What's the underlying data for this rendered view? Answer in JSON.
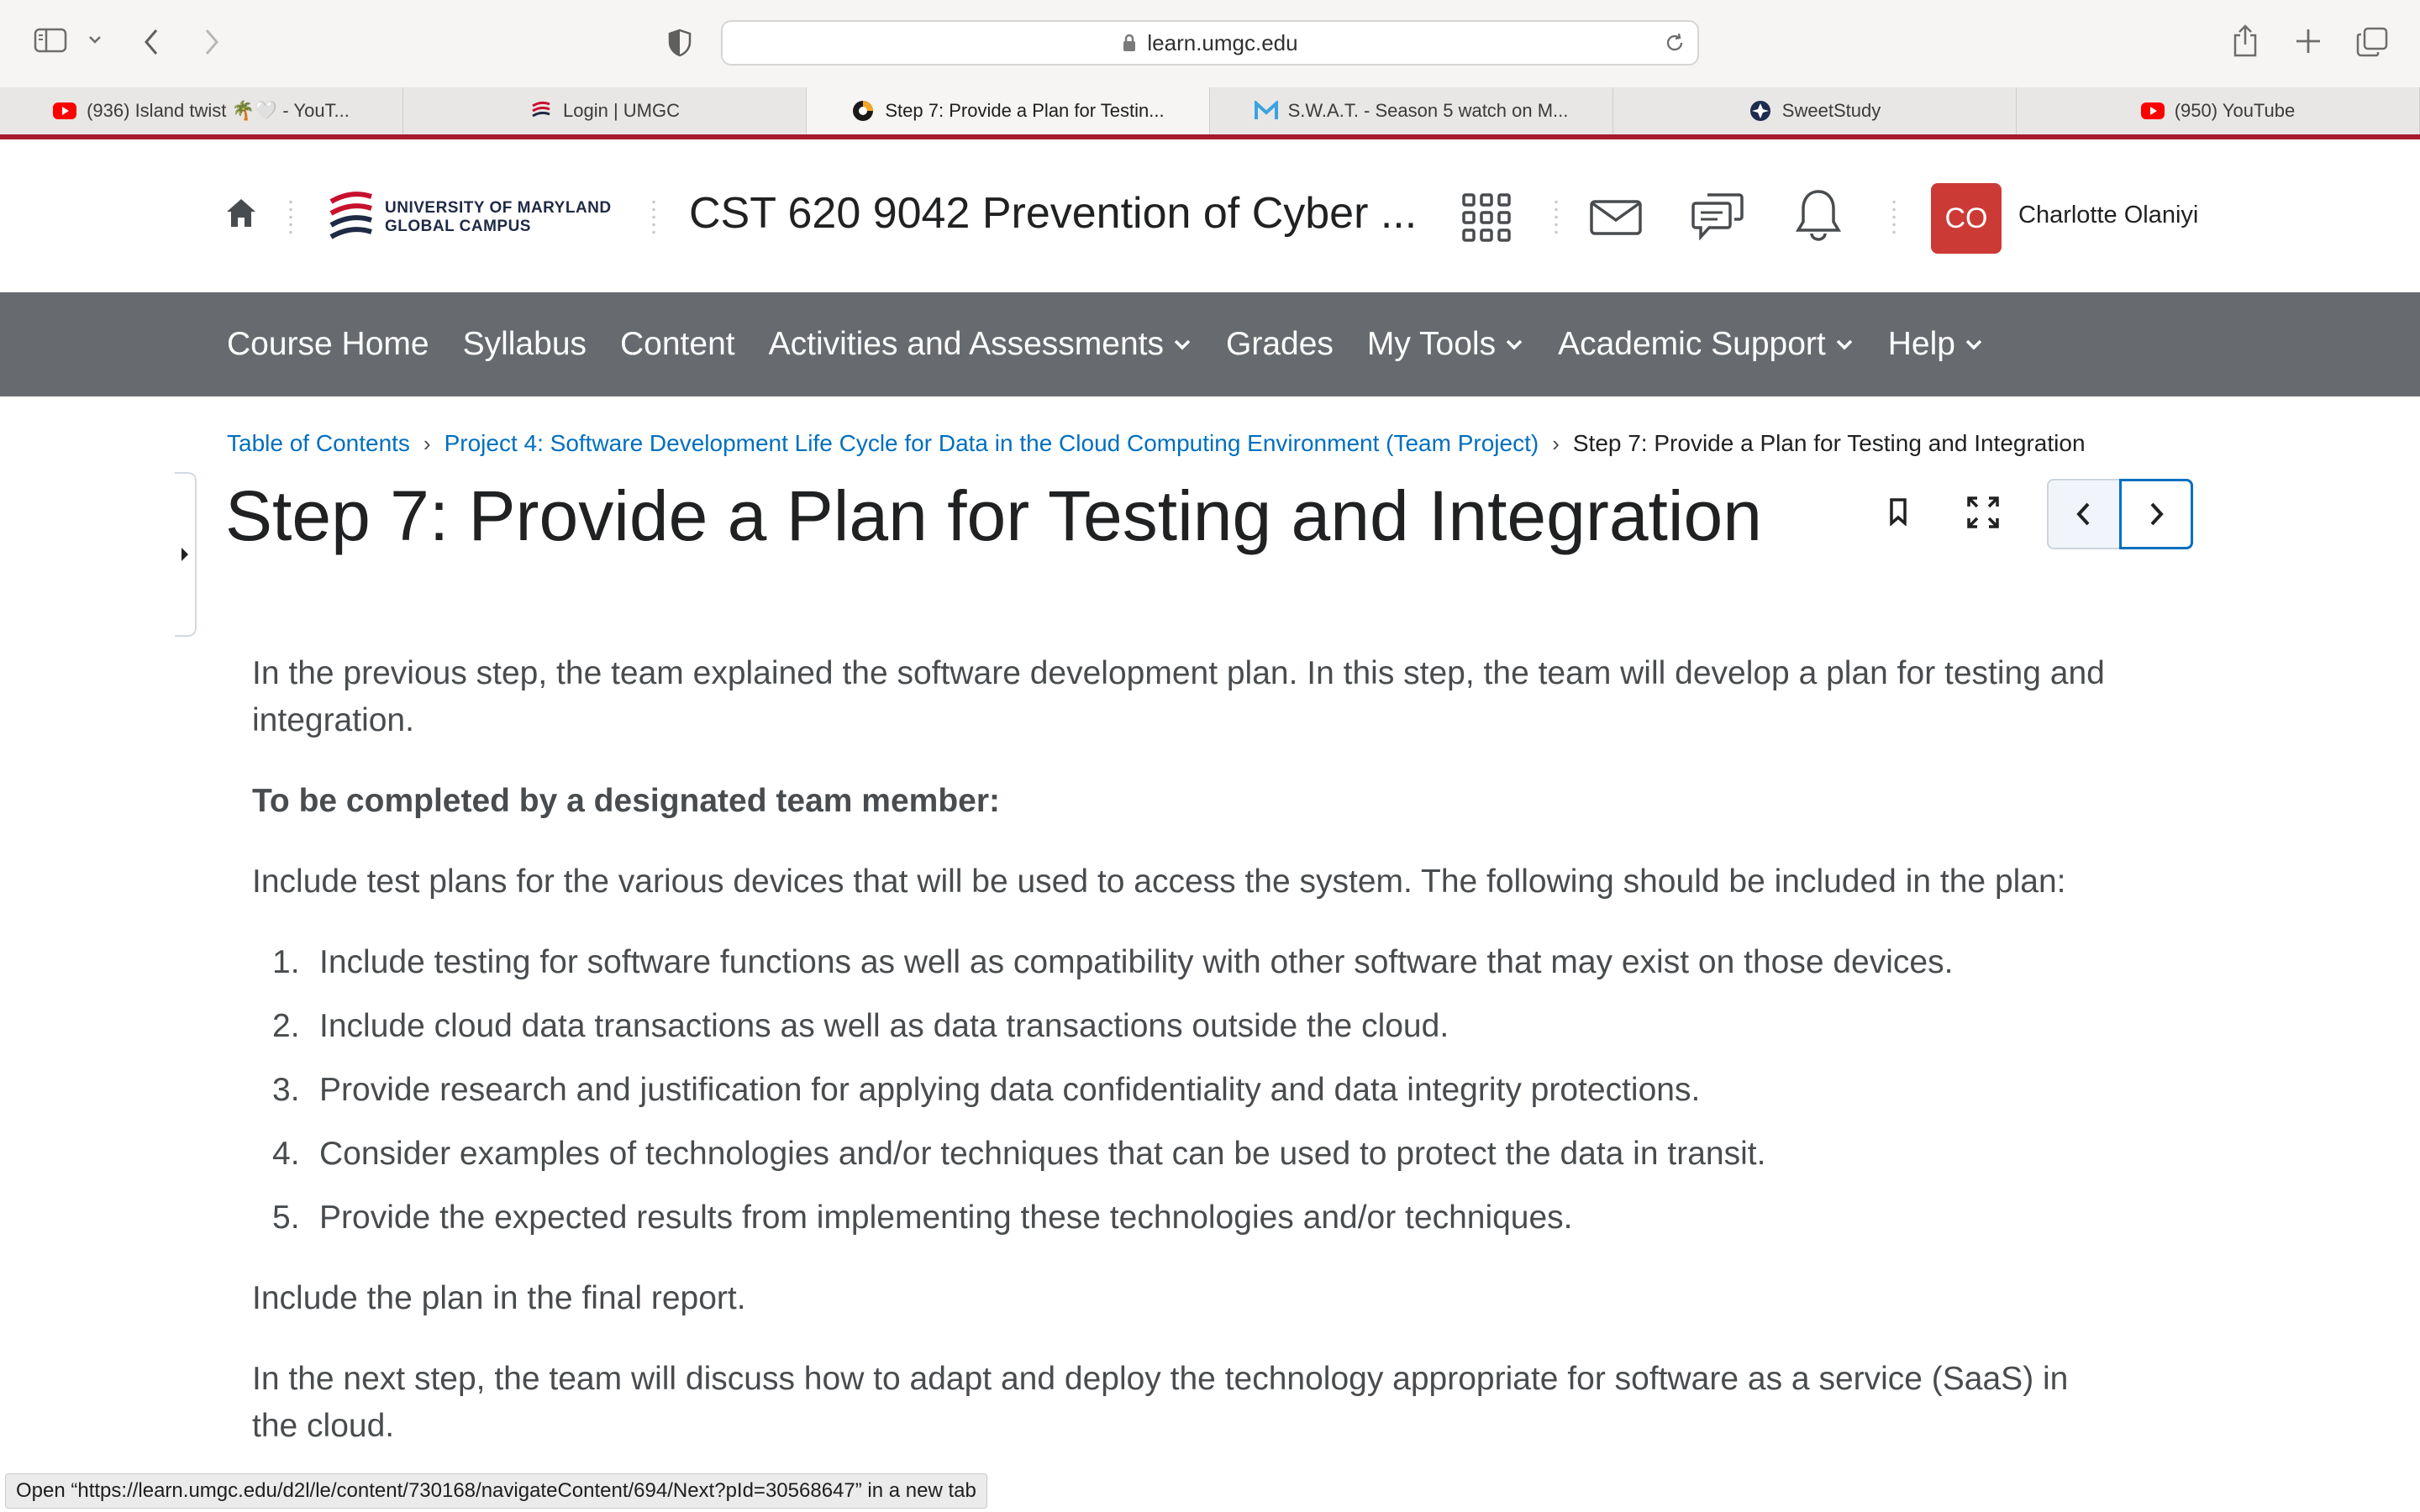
{
  "browser": {
    "url": "learn.umgc.edu",
    "tabs": [
      {
        "label": "(936) Island twist 🌴🤍 - YouT...",
        "favicon": "youtube-icon"
      },
      {
        "label": "Login | UMGC",
        "favicon": "umgc-logo-icon"
      },
      {
        "label": "Step 7: Provide a Plan for Testin...",
        "favicon": "d2l-icon"
      },
      {
        "label": "S.W.A.T. - Season 5 watch on M...",
        "favicon": "m-icon"
      },
      {
        "label": "SweetStudy",
        "favicon": "sweetstudy-icon"
      },
      {
        "label": "(950) YouTube",
        "favicon": "youtube-icon"
      }
    ],
    "active_tab": 2
  },
  "header": {
    "logo_line1": "UNIVERSITY OF MARYLAND",
    "logo_line2": "GLOBAL CAMPUS",
    "course_title": "CST 620 9042 Prevention of Cyber ...",
    "user_initials": "CO",
    "user_name": "Charlotte Olaniyi"
  },
  "navbar": {
    "items": [
      {
        "label": "Course Home"
      },
      {
        "label": "Syllabus"
      },
      {
        "label": "Content"
      },
      {
        "label": "Activities and Assessments"
      },
      {
        "label": "Grades"
      },
      {
        "label": "My Tools"
      },
      {
        "label": "Academic Support"
      },
      {
        "label": "Help"
      }
    ]
  },
  "breadcrumb": {
    "items": [
      "Table of Contents",
      "Project 4: Software Development Life Cycle for Data in the Cloud Computing Environment (Team Project)"
    ],
    "current": "Step 7: Provide a Plan for Testing and Integration"
  },
  "page": {
    "title": "Step 7: Provide a Plan for Testing and Integration",
    "intro": "In the previous step, the team explained the software development plan. In this step, the team will develop a plan for testing and integration.",
    "designated_heading": "To be completed by a designated team member:",
    "include_text": "Include test plans for the various devices that will be used to access the system. The following should be included in the plan:",
    "list": [
      {
        "num": "1.",
        "text": "Include testing for software functions as well as compatibility with other software that may exist on those devices."
      },
      {
        "num": "2.",
        "text": "Include cloud data transactions as well as data transactions outside the cloud."
      },
      {
        "num": "3.",
        "text": "Provide research and justification for applying data confidentiality and data integrity protections."
      },
      {
        "num": "4.",
        "text": "Consider examples of technologies and/or techniques that can be used to protect the data in transit."
      },
      {
        "num": "5.",
        "text": "Provide the expected results from implementing these technologies and/or techniques."
      }
    ],
    "final_text": "Include the plan in the final report.",
    "next_text": "In the next step, the team will discuss how to adapt and deploy the technology appropriate for software as a service (SaaS) in the cloud."
  },
  "statusbar": {
    "text": "Open “https://learn.umgc.edu/d2l/le/content/730168/navigateContent/694/Next?pId=30568647” in a new tab"
  },
  "colors": {
    "accent_red": "#a6192e",
    "navbar_gray": "#676b6f",
    "link_blue": "#006fbf",
    "avatar_red": "#cc3a36"
  }
}
